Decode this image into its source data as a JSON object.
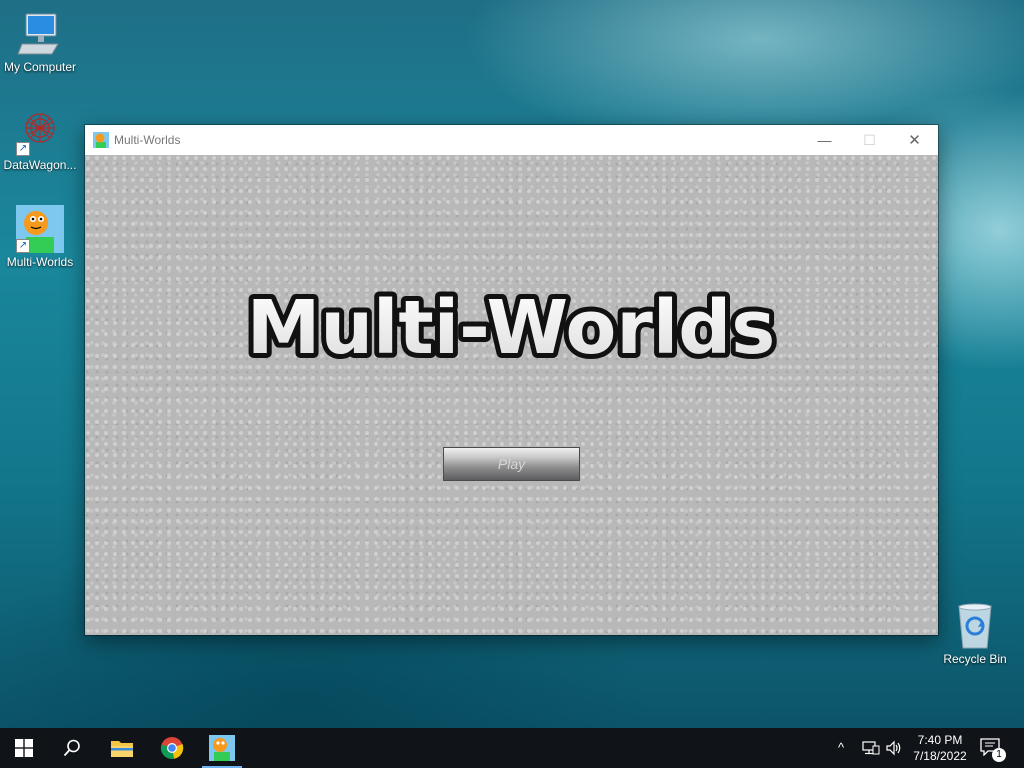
{
  "desktop": {
    "icons": [
      {
        "label": "My Computer",
        "icon": "computer-icon"
      },
      {
        "label": "DataWagon...",
        "icon": "datawagon-icon"
      },
      {
        "label": "Multi-Worlds",
        "icon": "multi-worlds-app-icon"
      },
      {
        "label": "Recycle Bin",
        "icon": "recycle-bin-icon"
      }
    ]
  },
  "window": {
    "title": "Multi-Worlds",
    "controls": {
      "minimize": "—",
      "maximize": "☐",
      "close": "✕"
    },
    "game": {
      "title": "Multi-Worlds",
      "play_label": "Play"
    }
  },
  "taskbar": {
    "apps": [
      "start-icon",
      "search-icon",
      "file-explorer-icon",
      "chrome-icon",
      "multi-worlds-taskbar-icon"
    ],
    "tray": {
      "chevron": "^",
      "time": "7:40 PM",
      "date": "7/18/2022",
      "notification_count": "1"
    }
  },
  "colors": {
    "desktop_teal": "#1a879c",
    "taskbar": "#101418",
    "window_body": "#b8b8b8"
  }
}
